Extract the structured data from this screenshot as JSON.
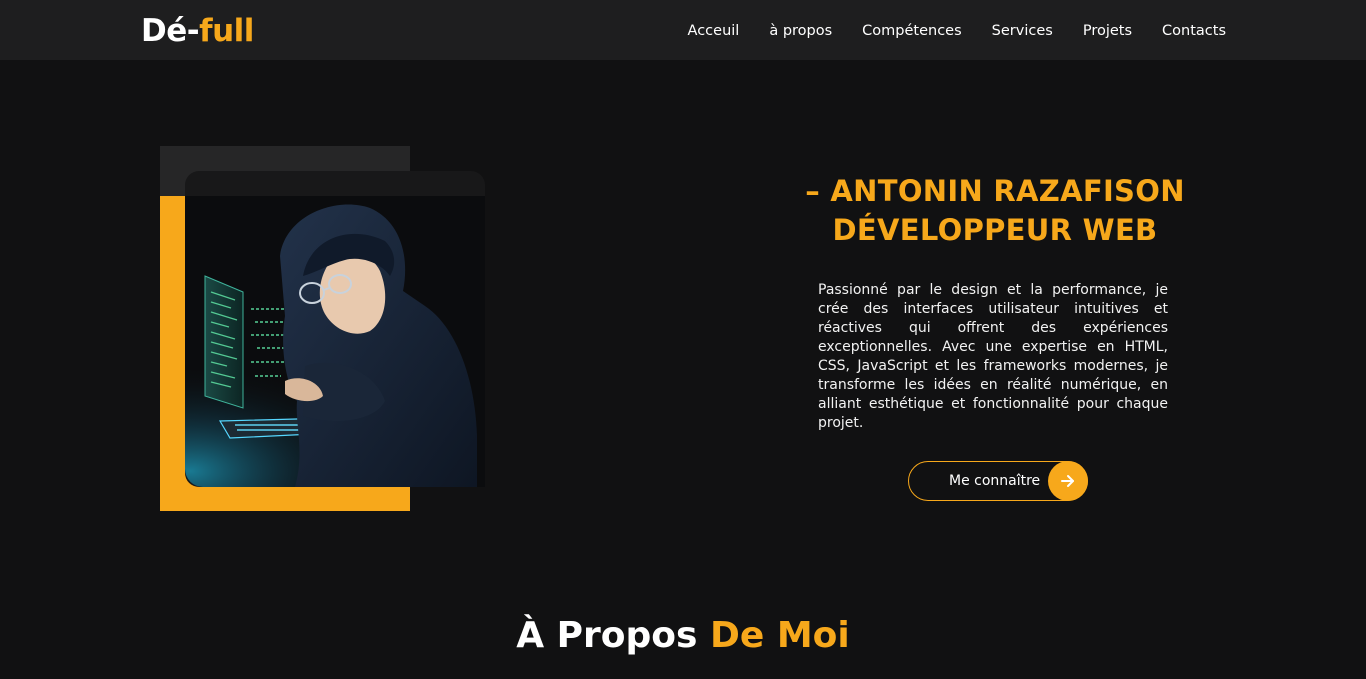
{
  "brand": {
    "logo_prefix": "Dé-",
    "logo_suffix": "full"
  },
  "nav": {
    "items": [
      {
        "label": "Acceuil"
      },
      {
        "label": "à propos"
      },
      {
        "label": "Compétences"
      },
      {
        "label": "Services"
      },
      {
        "label": "Projets"
      },
      {
        "label": "Contacts"
      }
    ]
  },
  "hero": {
    "title_line1": "– ANTONIN  RAZAFISON",
    "title_line2": "DÉVELOPPEUR WEB",
    "description": "Passionné par le design et la performance, je crée des interfaces utilisateur intuitives et réactives qui offrent des expériences exceptionnelles. Avec une expertise en HTML, CSS, JavaScript et les frameworks modernes, je transforme les idées en réalité numérique, en alliant esthétique et fonctionnalité pour chaque projet.",
    "cta_label": "Me connaître",
    "cta_icon": "arrow-right-icon",
    "image_subject": "boy-coding-laptop-illustration"
  },
  "about": {
    "title_prefix": "À Propos ",
    "title_accent": "De Moi"
  },
  "colors": {
    "accent": "#f7a81b",
    "background": "#111112",
    "navbar": "#1e1e1f"
  }
}
